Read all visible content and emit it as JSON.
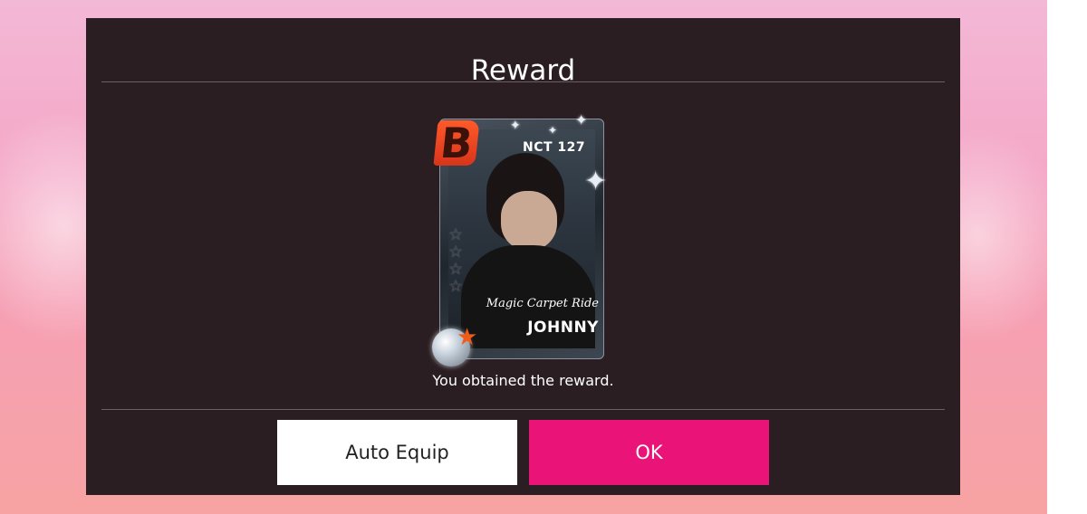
{
  "dialog": {
    "title": "Reward",
    "message": "You obtained the reward.",
    "buttons": {
      "auto_equip_label": "Auto Equip",
      "ok_label": "OK"
    }
  },
  "card": {
    "grade": "B",
    "group": "NCT 127",
    "title": "Magic Carpet Ride",
    "member": "JOHNNY",
    "stars_empty": "☆",
    "sparkle_glyph": "✦",
    "orb_star_glyph": "★"
  },
  "colors": {
    "dialog_bg": "#2a1e22",
    "ok_button": "#ea1377",
    "auto_button": "#ffffff",
    "grade_badge": "#e8401f"
  }
}
